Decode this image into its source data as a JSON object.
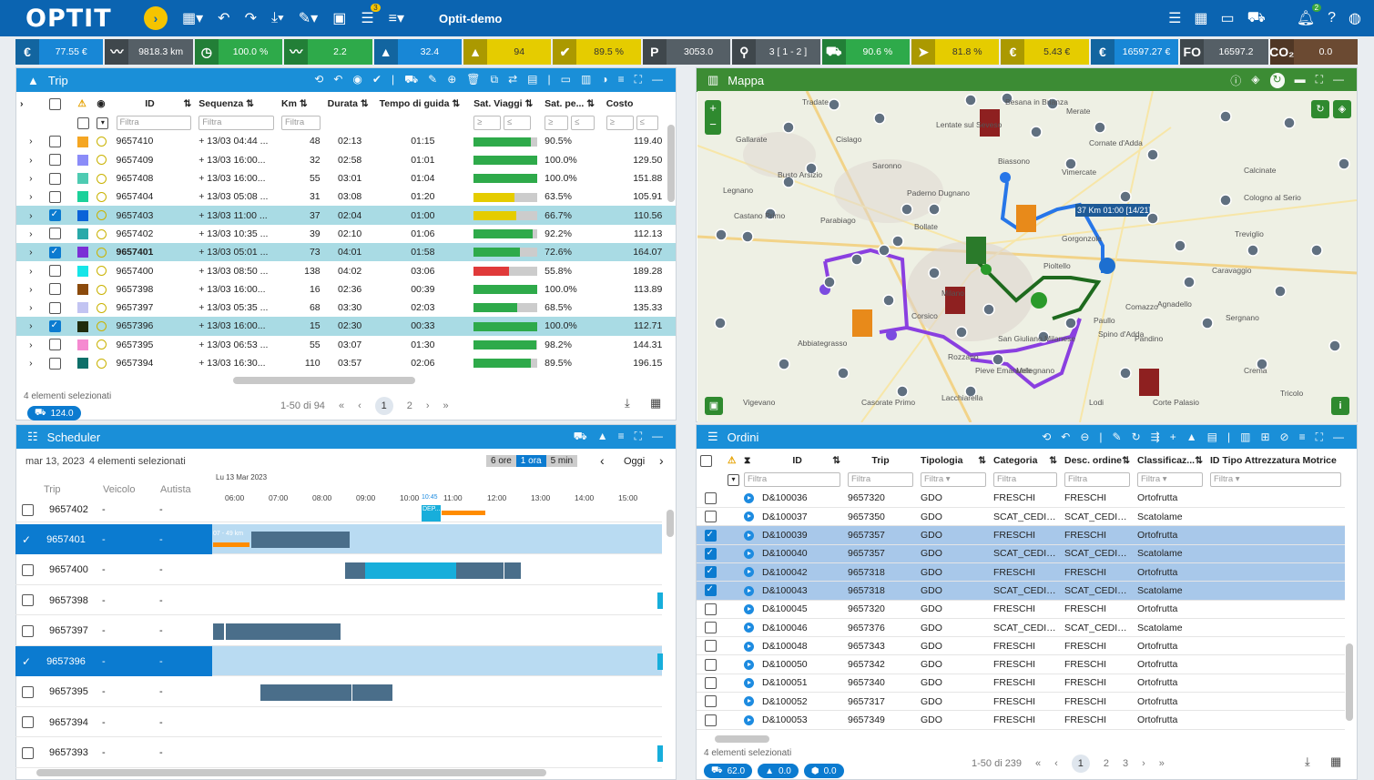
{
  "topbar": {
    "logo": "OPTIT",
    "app": "Optit-demo",
    "badge_tasks": "3",
    "badge_bell": "2"
  },
  "kpis": [
    {
      "icon": "€",
      "value": "77.55 €",
      "color": "#1887d6"
    },
    {
      "icon": "〰",
      "value": "9818.3 km",
      "color": "#555f66"
    },
    {
      "icon": "◷",
      "value": "100.0 %",
      "color": "#2eaa4a"
    },
    {
      "icon": "〰",
      "value": "2.2",
      "color": "#2eaa4a"
    },
    {
      "icon": "▲",
      "value": "32.4",
      "color": "#1887d6"
    },
    {
      "icon": "▲",
      "value": "94",
      "color": "#e5cc00"
    },
    {
      "icon": "✔",
      "value": "89.5 %",
      "color": "#e5cc00"
    },
    {
      "icon": "P",
      "value": "3053.0",
      "color": "#555f66"
    },
    {
      "icon": "⚲",
      "value": "3 [ 1 - 2 ]",
      "color": "#555f66"
    },
    {
      "icon": "⛟",
      "value": "90.6 %",
      "color": "#2eaa4a"
    },
    {
      "icon": "➤",
      "value": "81.8 %",
      "color": "#e5cc00"
    },
    {
      "icon": "€",
      "value": "5.43 €",
      "color": "#e5cc00"
    },
    {
      "icon": "€",
      "value": "16597.27 €",
      "color": "#1887d6"
    },
    {
      "icon": "FO",
      "value": "16597.2",
      "color": "#555f66"
    },
    {
      "icon": "CO₂",
      "value": "0.0",
      "color": "#6b4a32"
    }
  ],
  "trip": {
    "title": "Trip",
    "headers": [
      "ID",
      "Sequenza",
      "Km",
      "Durata",
      "Tempo di guida",
      "Sat. Viaggi",
      "Sat. pe...",
      "Costo"
    ],
    "filter": "Filtra",
    "rows": [
      {
        "color": "#f5a623",
        "sel": false,
        "bold": false,
        "id": "9657410",
        "seq": "+ 13/03 04:44 ...",
        "km": "48",
        "dur": "02:13",
        "drive": "01:15",
        "sat": 0.905,
        "satc": "#2eaa4a",
        "pct": "90.5%",
        "cost": "119.40"
      },
      {
        "color": "#8b8cf8",
        "sel": false,
        "bold": false,
        "id": "9657409",
        "seq": "+ 13/03 16:00...",
        "km": "32",
        "dur": "02:58",
        "drive": "01:01",
        "sat": 1.0,
        "satc": "#2eaa4a",
        "pct": "100.0%",
        "cost": "129.50"
      },
      {
        "color": "#4ecbb2",
        "sel": false,
        "bold": false,
        "id": "9657408",
        "seq": "+ 13/03 16:00...",
        "km": "55",
        "dur": "03:01",
        "drive": "01:04",
        "sat": 1.0,
        "satc": "#2eaa4a",
        "pct": "100.0%",
        "cost": "151.88"
      },
      {
        "color": "#1bd19a",
        "sel": false,
        "bold": false,
        "id": "9657404",
        "seq": "+ 13/03 05:08 ...",
        "km": "31",
        "dur": "03:08",
        "drive": "01:20",
        "sat": 0.635,
        "satc": "#e5cc00",
        "pct": "63.5%",
        "cost": "105.91"
      },
      {
        "color": "#0b63d8",
        "sel": true,
        "bold": false,
        "id": "9657403",
        "seq": "+ 13/03 11:00 ...",
        "km": "37",
        "dur": "02:04",
        "drive": "01:00",
        "sat": 0.667,
        "satc": "#e5cc00",
        "pct": "66.7%",
        "cost": "110.56"
      },
      {
        "color": "#2aa9a9",
        "sel": false,
        "bold": false,
        "id": "9657402",
        "seq": "+ 13/03 10:35 ...",
        "km": "39",
        "dur": "02:10",
        "drive": "01:06",
        "sat": 0.922,
        "satc": "#2eaa4a",
        "pct": "92.2%",
        "cost": "112.13"
      },
      {
        "color": "#7b2fd6",
        "sel": true,
        "bold": true,
        "id": "9657401",
        "seq": "+ 13/03 05:01 ...",
        "km": "73",
        "dur": "04:01",
        "drive": "01:58",
        "sat": 0.726,
        "satc": "#2eaa4a",
        "pct": "72.6%",
        "cost": "164.07"
      },
      {
        "color": "#16e5e8",
        "sel": false,
        "bold": false,
        "id": "9657400",
        "seq": "+ 13/03 08:50 ...",
        "km": "138",
        "dur": "04:02",
        "drive": "03:06",
        "sat": 0.558,
        "satc": "#e03a3a",
        "pct": "55.8%",
        "cost": "189.28"
      },
      {
        "color": "#8b4a0c",
        "sel": false,
        "bold": false,
        "id": "9657398",
        "seq": "+ 13/03 16:00...",
        "km": "16",
        "dur": "02:36",
        "drive": "00:39",
        "sat": 1.0,
        "satc": "#2eaa4a",
        "pct": "100.0%",
        "cost": "113.89"
      },
      {
        "color": "#c2c4f2",
        "sel": false,
        "bold": false,
        "id": "9657397",
        "seq": "+ 13/03 05:35 ...",
        "km": "68",
        "dur": "03:30",
        "drive": "02:03",
        "sat": 0.685,
        "satc": "#2eaa4a",
        "pct": "68.5%",
        "cost": "135.33"
      },
      {
        "color": "#1f2b0d",
        "sel": true,
        "bold": false,
        "id": "9657396",
        "seq": "+ 13/03 16:00...",
        "km": "15",
        "dur": "02:30",
        "drive": "00:33",
        "sat": 1.0,
        "satc": "#2eaa4a",
        "pct": "100.0%",
        "cost": "112.71"
      },
      {
        "color": "#f58ad0",
        "sel": false,
        "bold": false,
        "id": "9657395",
        "seq": "+ 13/03 06:53 ...",
        "km": "55",
        "dur": "03:07",
        "drive": "01:30",
        "sat": 0.982,
        "satc": "#2eaa4a",
        "pct": "98.2%",
        "cost": "144.31"
      },
      {
        "color": "#0e6f69",
        "sel": false,
        "bold": false,
        "id": "9657394",
        "seq": "+ 13/03 16:30...",
        "km": "110",
        "dur": "03:57",
        "drive": "02:06",
        "sat": 0.895,
        "satc": "#2eaa4a",
        "pct": "89.5%",
        "cost": "196.15"
      }
    ],
    "selected": "4 elementi selezionati",
    "pager": "1-50 di 94",
    "page1": "1",
    "page2": "2",
    "pill": "124.0"
  },
  "map": {
    "title": "Mappa",
    "places": [
      "Tradate",
      "Besana in Brianza",
      "Merate",
      "Gallarate",
      "Cislago",
      "Lentate sul Seveso",
      "Cornate d'Adda",
      "Busto Arsizio",
      "Saronno",
      "Biassono",
      "Vimercate",
      "Calcinate",
      "Legnano",
      "Castano Primo",
      "Parabiago",
      "Paderno Dugnano",
      "Bollate",
      "Cologno al Serio",
      "Treviglio",
      "Corsico",
      "Milano",
      "Pioltello",
      "Gorgonzola",
      "Caravaggio",
      "Abbiategrasso",
      "Rozzano",
      "San Giuliano Milanese",
      "Crema",
      "Vigevano",
      "Casorate Primo",
      "Lacchiarella",
      "Pieve Emanuele",
      "Melegnano",
      "Lodi",
      "Corte Palasio",
      "Tricolo",
      "Sergnano",
      "Pandino",
      "Spino d'Adda",
      "Comazzo",
      "Agnadello",
      "Paullo"
    ],
    "route_label": "37 Km 01:00 [14/21]"
  },
  "sched": {
    "title": "Scheduler",
    "date": "mar 13, 2023",
    "selected": "4 elementi selezionati",
    "zoom": [
      "6 ore",
      "1 ora",
      "5 min"
    ],
    "today": "Oggi",
    "cols": [
      "Trip",
      "Veicolo",
      "Autista"
    ],
    "day": "Lu 13 Mar 2023",
    "hours": [
      "06:00",
      "07:00",
      "08:00",
      "09:00",
      "10:00",
      "11:00",
      "12:00",
      "13:00",
      "14:00",
      "15:00"
    ],
    "now": "10:45",
    "rows": [
      {
        "id": "9657401",
        "v": "-",
        "a": "-"
      },
      {
        "id": "9657400",
        "v": "-",
        "a": "-"
      },
      {
        "id": "9657398",
        "v": "-",
        "a": "-"
      },
      {
        "id": "9657397",
        "v": "-",
        "a": "-"
      },
      {
        "id": "9657396",
        "v": "-",
        "a": "-"
      },
      {
        "id": "9657395",
        "v": "-",
        "a": "-"
      },
      {
        "id": "9657394",
        "v": "-",
        "a": "-"
      },
      {
        "id": "9657393",
        "v": "-",
        "a": "-"
      }
    ],
    "partial": "9657402",
    "boxes": {
      "b1": "07 - 49 km",
      "b2": "24 Roll PV-141 - G...",
      "b3": "00:50 - 2...",
      "b4": "10 R... PV-1...",
      "b5": "12 ... DEP...",
      "b6": "02:03 - 69 km",
      "b7": "01:03 - 59 k...",
      "b8": "11 ... PV...",
      "b9": "00:43 - ...",
      "b10": "00:58 - 22 k...",
      "b11": "5 Roll PV-6...",
      "b12": "36 ... DEP...",
      "b13": "00:57 - 37 ...",
      "b14": "00:3...",
      "b15": "34 Roll PV-190 - P...",
      "b16": "DEP..."
    }
  },
  "ordini": {
    "title": "Ordini",
    "headers": [
      "ID",
      "Trip",
      "Tipologia",
      "Categoria",
      "Desc. ordine",
      "Classificaz...",
      "ID Tipo Attrezzatura Motrice"
    ],
    "filter": "Filtra",
    "rows": [
      {
        "sel": false,
        "id": "D&100036",
        "trip": "9657320",
        "tip": "GDO",
        "cat": "FRESCHI",
        "desc": "FRESCHI",
        "cls": "Ortofrutta"
      },
      {
        "sel": false,
        "id": "D&100037",
        "trip": "9657350",
        "tip": "GDO",
        "cat": "SCAT_CEDI_FR",
        "desc": "SCAT_CEDI_FR",
        "cls": "Scatolame"
      },
      {
        "sel": true,
        "id": "D&100039",
        "trip": "9657357",
        "tip": "GDO",
        "cat": "FRESCHI",
        "desc": "FRESCHI",
        "cls": "Ortofrutta"
      },
      {
        "sel": true,
        "id": "D&100040",
        "trip": "9657357",
        "tip": "GDO",
        "cat": "SCAT_CEDI_FR",
        "desc": "SCAT_CEDI_FR",
        "cls": "Scatolame"
      },
      {
        "sel": true,
        "id": "D&100042",
        "trip": "9657318",
        "tip": "GDO",
        "cat": "FRESCHI",
        "desc": "FRESCHI",
        "cls": "Ortofrutta"
      },
      {
        "sel": true,
        "id": "D&100043",
        "trip": "9657318",
        "tip": "GDO",
        "cat": "SCAT_CEDI_FR",
        "desc": "SCAT_CEDI_FR",
        "cls": "Scatolame"
      },
      {
        "sel": false,
        "id": "D&100045",
        "trip": "9657320",
        "tip": "GDO",
        "cat": "FRESCHI",
        "desc": "FRESCHI",
        "cls": "Ortofrutta"
      },
      {
        "sel": false,
        "id": "D&100046",
        "trip": "9657376",
        "tip": "GDO",
        "cat": "SCAT_CEDI_FR",
        "desc": "SCAT_CEDI_FR",
        "cls": "Scatolame"
      },
      {
        "sel": false,
        "id": "D&100048",
        "trip": "9657343",
        "tip": "GDO",
        "cat": "FRESCHI",
        "desc": "FRESCHI",
        "cls": "Ortofrutta"
      },
      {
        "sel": false,
        "id": "D&100050",
        "trip": "9657342",
        "tip": "GDO",
        "cat": "FRESCHI",
        "desc": "FRESCHI",
        "cls": "Ortofrutta"
      },
      {
        "sel": false,
        "id": "D&100051",
        "trip": "9657340",
        "tip": "GDO",
        "cat": "FRESCHI",
        "desc": "FRESCHI",
        "cls": "Ortofrutta"
      },
      {
        "sel": false,
        "id": "D&100052",
        "trip": "9657317",
        "tip": "GDO",
        "cat": "FRESCHI",
        "desc": "FRESCHI",
        "cls": "Ortofrutta"
      },
      {
        "sel": false,
        "id": "D&100053",
        "trip": "9657349",
        "tip": "GDO",
        "cat": "FRESCHI",
        "desc": "FRESCHI",
        "cls": "Ortofrutta"
      }
    ],
    "selected": "4 elementi selezionati",
    "pager": "1-50 di 239",
    "p1": "1",
    "p2": "2",
    "p3": "3",
    "pills": [
      "62.0",
      "0.0",
      "0.0"
    ]
  }
}
